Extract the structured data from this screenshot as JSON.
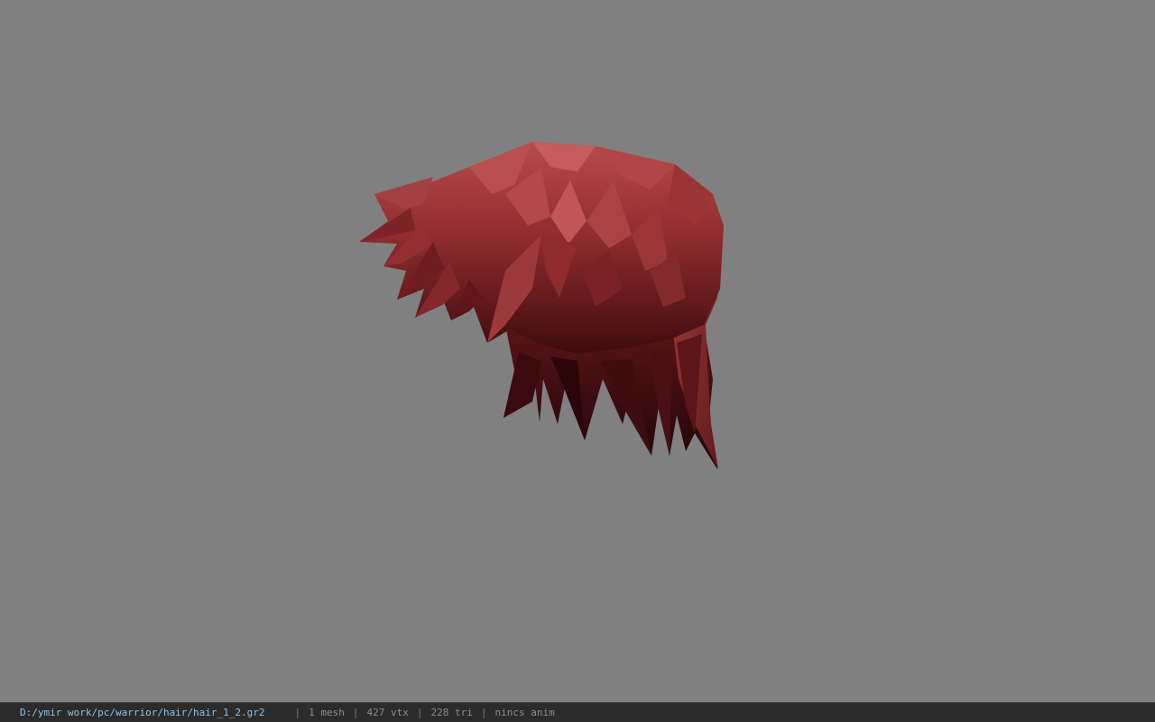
{
  "status_bar": {
    "file_path": "D:/ymir work/pc/warrior/hair/hair_1_2.gr2",
    "separator": "|",
    "mesh_count": "1 mesh",
    "vertex_count": "427 vtx",
    "triangle_count": "228 tri",
    "anim_status": "nincs anim"
  },
  "colors": {
    "viewport_background": "#808080",
    "status_bar_background": "#2b2b2b",
    "path_text": "#8fc1e8",
    "stat_text": "#8c8c8c",
    "hair_light": "#b5504f",
    "hair_mid": "#8a2a2c",
    "hair_dark": "#2c080b"
  },
  "viewport": {
    "model": "red-spiky-hair-mesh"
  }
}
